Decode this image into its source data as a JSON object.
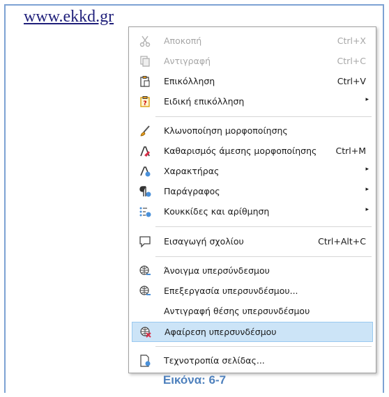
{
  "url_text": "www.ekkd.gr",
  "caption": "Εικόνα: 6-7",
  "menu": {
    "cut": {
      "label": "Αποκοπή",
      "shortcut": "Ctrl+X",
      "icon": "scissors-icon"
    },
    "copy": {
      "label": "Αντιγραφή",
      "shortcut": "Ctrl+C",
      "icon": "copy-icon"
    },
    "paste": {
      "label": "Επικόλληση",
      "shortcut": "Ctrl+V",
      "icon": "paste-icon"
    },
    "paste_special": {
      "label": "Ειδική επικόλληση",
      "arrow": "▸",
      "icon": "paste-special-icon"
    },
    "clone_formatting": {
      "label": "Κλωνοποίηση μορφοποίησης",
      "icon": "paintbrush-icon"
    },
    "clear_formatting": {
      "label": "Καθαρισμός άμεσης μορφοποίησης",
      "shortcut": "Ctrl+M",
      "icon": "clear-format-icon"
    },
    "character": {
      "label": "Χαρακτήρας",
      "arrow": "▸",
      "icon": "character-icon"
    },
    "paragraph": {
      "label": "Παράγραφος",
      "arrow": "▸",
      "icon": "paragraph-icon"
    },
    "bullets": {
      "label": "Κουκκίδες και αρίθμηση",
      "arrow": "▸",
      "icon": "bullets-icon"
    },
    "insert_comment": {
      "label": "Εισαγωγή σχολίου",
      "shortcut": "Ctrl+Alt+C",
      "icon": "comment-icon"
    },
    "open_hyperlink": {
      "label": "Άνοιγμα υπερσύνδεσμου",
      "icon": "globe-link-icon"
    },
    "edit_hyperlink": {
      "label": "Επεξεργασία υπερσυνδέσμου...",
      "icon": "globe-edit-icon"
    },
    "copy_hyperlink_location": {
      "label": "Αντιγραφή θέσης υπερσυνδέσμου"
    },
    "remove_hyperlink": {
      "label": "Αφαίρεση υπερσυνδέσμου",
      "icon": "globe-remove-icon",
      "highlighted": true
    },
    "page_style": {
      "label": "Τεχνοτροπία σελίδας...",
      "icon": "page-style-icon"
    }
  },
  "colors": {
    "highlight": "#cce4f7",
    "caption": "#4f81bd",
    "frame": "#7da2d3"
  }
}
